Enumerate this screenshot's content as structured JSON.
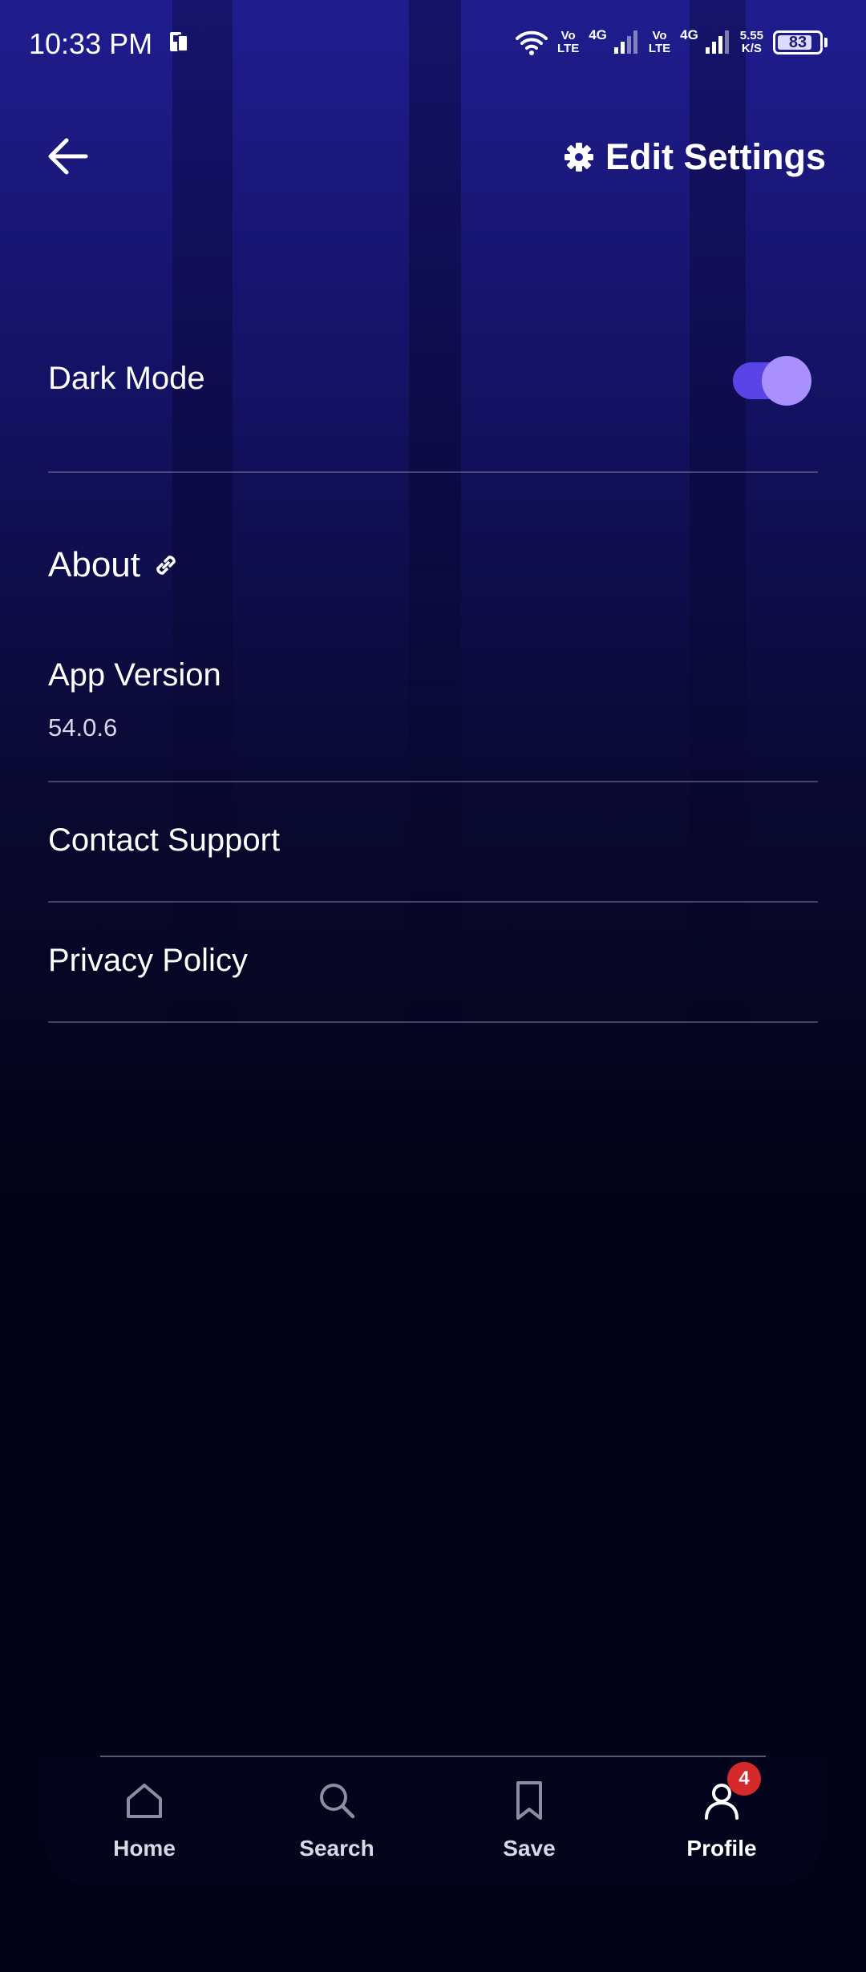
{
  "status_bar": {
    "time": "10:33 PM",
    "sim1_volte_top": "Vo",
    "sim1_volte_bottom": "LTE",
    "sim1_net": "4G",
    "sim2_volte_top": "Vo",
    "sim2_volte_bottom": "LTE",
    "sim2_net": "4G",
    "speed_value": "5.55",
    "speed_unit": "K/S",
    "battery": "83",
    "battery_level": 0.83
  },
  "header": {
    "back_icon": "arrow-left-icon",
    "edit_settings_icon": "gear-icon",
    "edit_settings_label": "Edit Settings"
  },
  "settings": {
    "dark_mode_label": "Dark Mode",
    "dark_mode_enabled": true,
    "about_label": "About",
    "about_icon": "link-icon",
    "app_version_label": "App Version",
    "app_version_value": "54.0.6",
    "contact_support_label": "Contact Support",
    "privacy_policy_label": "Privacy Policy"
  },
  "bottom_nav": {
    "items": [
      {
        "label": "Home",
        "icon": "home-icon"
      },
      {
        "label": "Search",
        "icon": "search-icon"
      },
      {
        "label": "Save",
        "icon": "bookmark-icon"
      },
      {
        "label": "Profile",
        "icon": "user-icon",
        "active": true
      }
    ],
    "profile_badge": "4"
  },
  "colors": {
    "background_top": "#211e96",
    "background_bottom": "#030216",
    "toggle_track": "#5b44e6",
    "toggle_knob": "#a890ff",
    "badge": "#d62a2a"
  }
}
